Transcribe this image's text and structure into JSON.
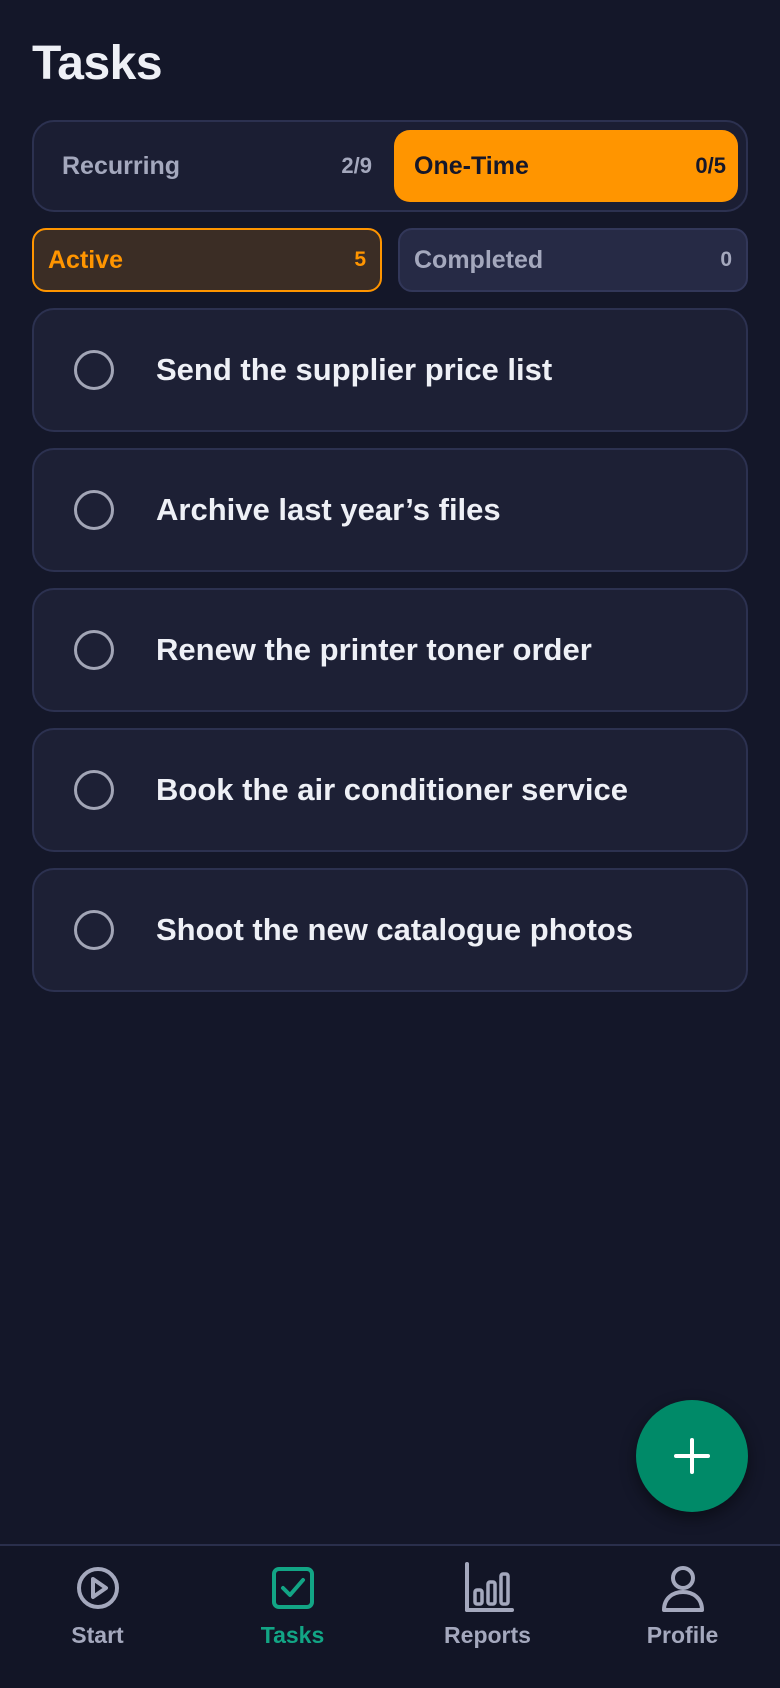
{
  "header": {
    "title": "Tasks"
  },
  "segment": {
    "recurring_label": "Recurring",
    "recurring_count": "2/9",
    "onetime_label": "One-Time",
    "onetime_count": "0/5",
    "selected": "One-Time"
  },
  "filters": {
    "active_label": "Active",
    "active_count": "5",
    "completed_label": "Completed",
    "completed_count": "0",
    "selected": "Active"
  },
  "tasks": [
    {
      "title": "Send the supplier price list",
      "done": false
    },
    {
      "title": "Archive last year’s files",
      "done": false
    },
    {
      "title": "Renew the printer toner order",
      "done": false
    },
    {
      "title": "Book the air conditioner service",
      "done": false
    },
    {
      "title": "Shoot the new catalogue photos",
      "done": false
    }
  ],
  "fab": {
    "icon": "plus-icon"
  },
  "nav": {
    "items": [
      {
        "label": "Start",
        "icon": "play-circle-icon"
      },
      {
        "label": "Tasks",
        "icon": "checkbox-icon"
      },
      {
        "label": "Reports",
        "icon": "bar-chart-icon"
      },
      {
        "label": "Profile",
        "icon": "person-icon"
      }
    ],
    "active": "Tasks"
  },
  "colors": {
    "background": "#141729",
    "accent_orange": "#ff9500",
    "accent_green": "#008a68",
    "nav_active": "#12a585"
  }
}
